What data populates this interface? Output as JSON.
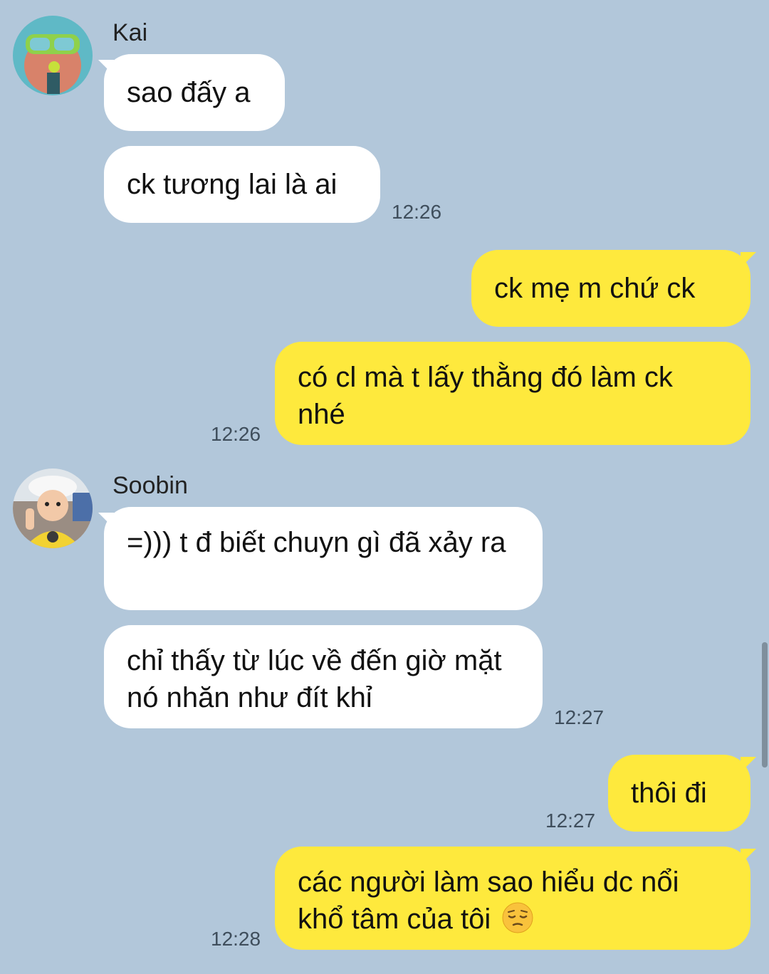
{
  "messages": {
    "kai": {
      "name": "Kai",
      "msg1": "sao đấy a",
      "msg2": "ck tương lai là ai",
      "time": "12:26"
    },
    "me1": {
      "msg1": "ck mẹ m chứ ck",
      "msg2": "có cl mà t lấy thằng đó làm ck nhé",
      "time": "12:26"
    },
    "soobin": {
      "name": "Soobin",
      "msg1": "=))) t đ biết chuyn gì đã xảy ra",
      "msg2": "chỉ thấy từ lúc về đến giờ mặt nó nhăn như đít khỉ",
      "time": "12:27"
    },
    "me2": {
      "msg1": "thôi đi",
      "time1": "12:27",
      "msg2": "các người làm sao hiểu dc nổi khổ tâm của tôi",
      "msg2_emoji": "pensive-face-emoji",
      "time2": "12:28"
    }
  },
  "colors": {
    "background": "#b2c7da",
    "incoming_bubble": "#ffffff",
    "outgoing_bubble": "#fee93d"
  }
}
